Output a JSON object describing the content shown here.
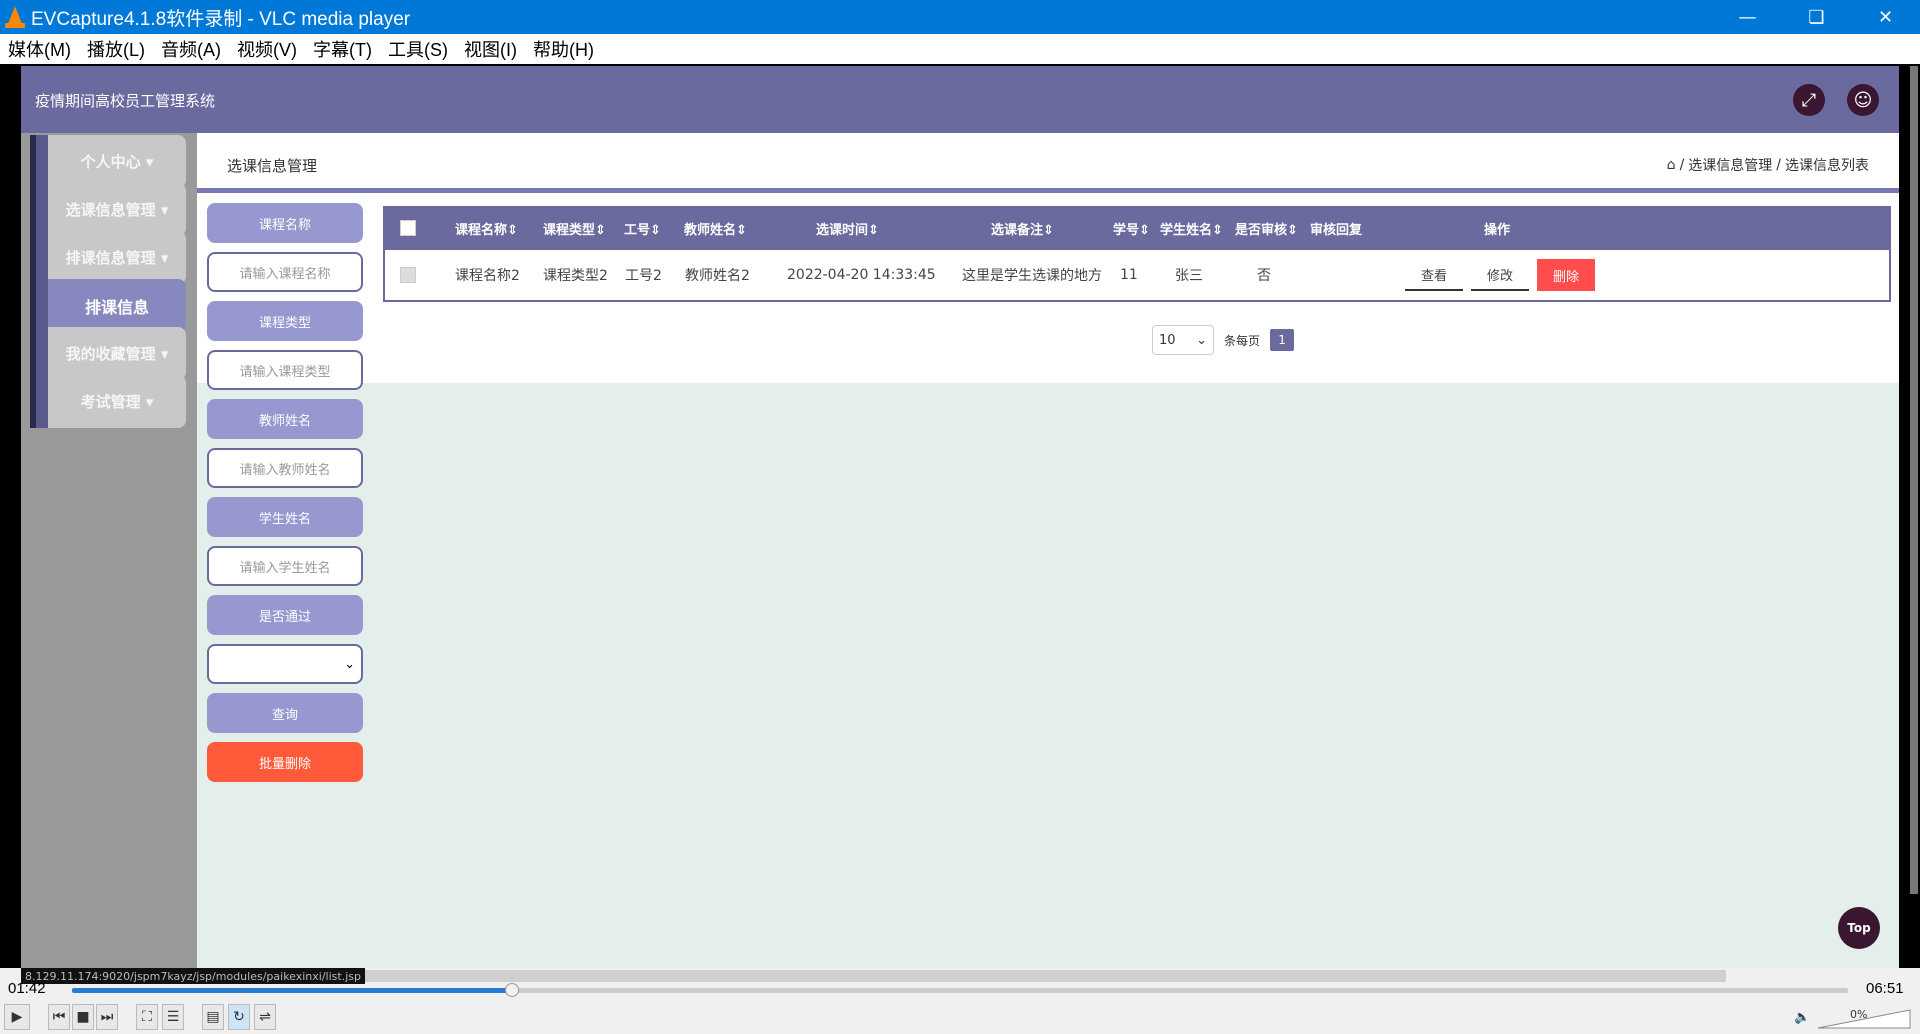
{
  "window": {
    "title": "EVCapture4.1.8软件录制 - VLC media player"
  },
  "menubar": [
    "媒体(M)",
    "播放(L)",
    "音频(A)",
    "视频(V)",
    "字幕(T)",
    "工具(S)",
    "视图(I)",
    "帮助(H)"
  ],
  "app": {
    "title": "疫情期间高校员工管理系统",
    "sidebar": [
      {
        "label": "个人中心",
        "caret": "▾"
      },
      {
        "label": "选课信息管理",
        "caret": "▾"
      },
      {
        "label": "排课信息管理",
        "caret": "▾"
      },
      {
        "label": "排课信息",
        "caret": ""
      },
      {
        "label": "我的收藏管理",
        "caret": "▾"
      },
      {
        "label": "考试管理",
        "caret": "▾"
      }
    ],
    "page_title": "选课信息管理",
    "breadcrumb": [
      "选课信息管理",
      "选课信息列表"
    ],
    "filters": {
      "course_name_label": "课程名称",
      "course_name_placeholder": "请输入课程名称",
      "course_type_label": "课程类型",
      "course_type_placeholder": "请输入课程类型",
      "teacher_label": "教师姓名",
      "teacher_placeholder": "请输入教师姓名",
      "student_label": "学生姓名",
      "student_placeholder": "请输入学生姓名",
      "passed_label": "是否通过",
      "passed_value": "",
      "query_label": "查询",
      "batch_delete_label": "批量删除"
    },
    "table": {
      "headers": [
        "课程名称⇕",
        "课程类型⇕",
        "工号⇕",
        "教师姓名⇕",
        "选课时间⇕",
        "选课备注⇕",
        "学号⇕",
        "学生姓名⇕",
        "是否审核⇕",
        "审核回复",
        "操作"
      ],
      "rows": [
        {
          "cells": [
            "课程名称2",
            "课程类型2",
            "工号2",
            "教师姓名2",
            "2022-04-20 14:33:45",
            "这里是学生选课的地方",
            "11",
            "张三",
            "否",
            ""
          ],
          "actions": [
            "查看",
            "修改",
            "删除"
          ]
        }
      ]
    },
    "pager": {
      "page_size": "10",
      "per_page_label": "条每页",
      "current_page": "1"
    },
    "top_button": "Top"
  },
  "status_url": "8.129.11.174:9020/jspm7kayz/jsp/modules/paikexinxi/list.jsp",
  "player": {
    "elapsed": "01:42",
    "total": "06:51",
    "progress_fraction": 0.248,
    "volume": "0%"
  }
}
